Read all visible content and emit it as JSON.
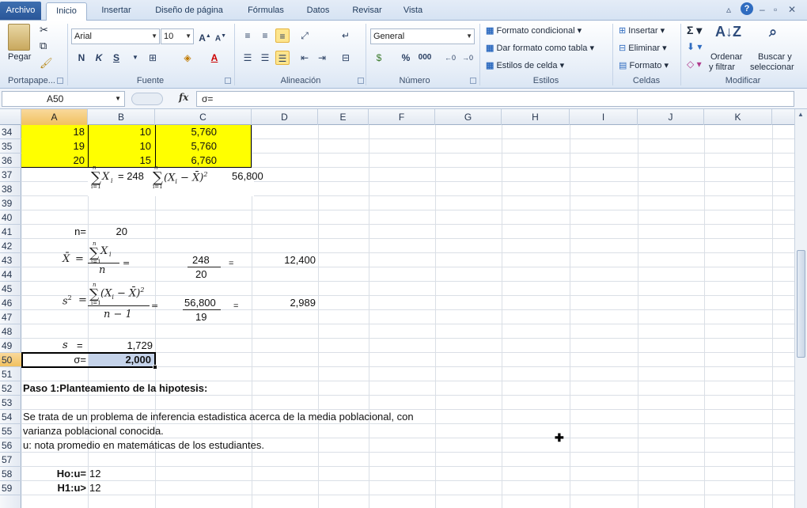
{
  "tabs": [
    "Archivo",
    "Inicio",
    "Insertar",
    "Diseño de página",
    "Fórmulas",
    "Datos",
    "Revisar",
    "Vista"
  ],
  "ribbon": {
    "clipboard": {
      "paste": "Pegar",
      "label": "Portapape..."
    },
    "font": {
      "name": "Arial",
      "size": "10",
      "bold": "N",
      "italic": "K",
      "underline": "S",
      "label": "Fuente"
    },
    "alignment": {
      "label": "Alineación"
    },
    "number": {
      "format": "General",
      "percent": "%",
      "thousands": "000",
      "label": "Número"
    },
    "styles": {
      "conditional": "Formato condicional",
      "as_table": "Dar formato como tabla",
      "cell_styles": "Estilos de celda",
      "label": "Estilos"
    },
    "cells": {
      "insert": "Insertar",
      "delete": "Eliminar",
      "format": "Formato",
      "label": "Celdas"
    },
    "editing": {
      "sort1": "Ordenar",
      "sort2": "y filtrar",
      "find1": "Buscar y",
      "find2": "seleccionar",
      "label": "Modificar"
    }
  },
  "formula_bar": {
    "name_box": "A50",
    "fx": "fx",
    "content": "σ="
  },
  "columns": [
    "A",
    "B",
    "C",
    "D",
    "E",
    "F",
    "G",
    "H",
    "I",
    "J",
    "K"
  ],
  "rows": [
    "34",
    "35",
    "36",
    "37",
    "38",
    "39",
    "40",
    "41",
    "42",
    "43",
    "44",
    "45",
    "46",
    "47",
    "48",
    "49",
    "50",
    "51",
    "52",
    "53",
    "54",
    "55",
    "56",
    "57",
    "58",
    "59"
  ],
  "cells": {
    "r34": {
      "a": "18",
      "b": "10",
      "c": "5,760"
    },
    "r35": {
      "a": "19",
      "b": "10",
      "c": "5,760"
    },
    "r36": {
      "a": "20",
      "b": "15",
      "c": "6,760"
    },
    "r37": {
      "sum1_eq": "= 248",
      "sum2_val": "56,800"
    },
    "r41": {
      "label": "n=",
      "value": "20"
    },
    "r43": {
      "num": "248",
      "den": "20",
      "eq": "=",
      "result": "12,400"
    },
    "r46": {
      "num": "56,800",
      "den": "19",
      "eq": "=",
      "result": "2,989"
    },
    "r49": {
      "label": "s",
      "eq": "=",
      "value": "1,729"
    },
    "r50": {
      "label": "σ=",
      "value": "2,000"
    },
    "r52": {
      "text": "Paso 1:Planteamiento de la hipotesis:"
    },
    "r54": {
      "text": "Se trata de un problema de inferencia estadistica acerca de la media poblacional, con"
    },
    "r55": {
      "text": "varianza poblacional conocida."
    },
    "r56": {
      "text": "u: nota promedio en matemáticas de los estudiantes."
    },
    "r58": {
      "label": "Ho:u=",
      "value": "12"
    },
    "r59": {
      "label": "H1:u>",
      "value": "12"
    }
  },
  "math": {
    "sum": "∑",
    "n": "n",
    "i1": "i=1",
    "xi": "X",
    "sub_i": "i",
    "xbar": "X̄",
    "dev": "(X",
    "minus_xbar": " − X̄)",
    "sq": "2",
    "n_minus_1": "n − 1",
    "s2": "s",
    "eq": "="
  }
}
